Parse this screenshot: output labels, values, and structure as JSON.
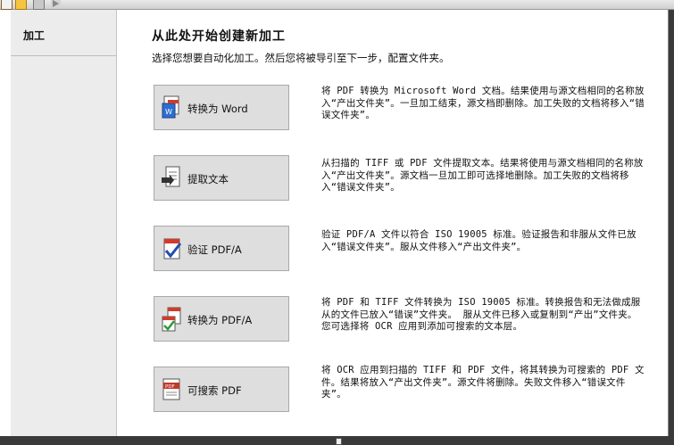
{
  "sidebar": {
    "items": [
      {
        "label": "加工"
      }
    ]
  },
  "main": {
    "heading": "从此处开始创建新加工",
    "subheading": "选择您想要自动化加工。然后您将被导引至下一步，配置文件夹。",
    "operations": [
      {
        "label": "转换为 Word",
        "icon": "convert-to-word-icon",
        "description": "将 PDF 转换为 Microsoft Word 文档。结果使用与源文档相同的名称放入“产出文件夹”。一旦加工结束，源文档即删除。加工失败的文档将移入“错误文件夹”。"
      },
      {
        "label": "提取文本",
        "icon": "extract-text-icon",
        "description": "从扫描的 TIFF 或 PDF 文件提取文本。结果将使用与源文档相同的名称放入“产出文件夹”。源文档一旦加工即可选择地删除。加工失败的文档将移入“错误文件夹”。"
      },
      {
        "label": "验证 PDF/A",
        "icon": "validate-pdfa-icon",
        "description": "验证 PDF/A 文件以符合 ISO 19005 标准。验证报告和非服从文件已放入“错误文件夹”。服从文件移入“产出文件夹”。"
      },
      {
        "label": "转换为 PDF/A",
        "icon": "convert-to-pdfa-icon",
        "description": "将 PDF 和 TIFF 文件转换为 ISO 19005 标准。转换报告和无法做成服从的文件已放入“错误”文件夹。 服从文件已移入或复制到“产出”文件夹。您可选择将 OCR 应用到添加可搜索的文本层。"
      },
      {
        "label": "可搜索 PDF",
        "icon": "searchable-pdf-icon",
        "description": "将 OCR 应用到扫描的 TIFF 和 PDF 文件，将其转换为可搜索的 PDF 文件。结果将放入“产出文件夹”。源文件将删除。失败文件移入“错误文件夹”。"
      }
    ]
  }
}
